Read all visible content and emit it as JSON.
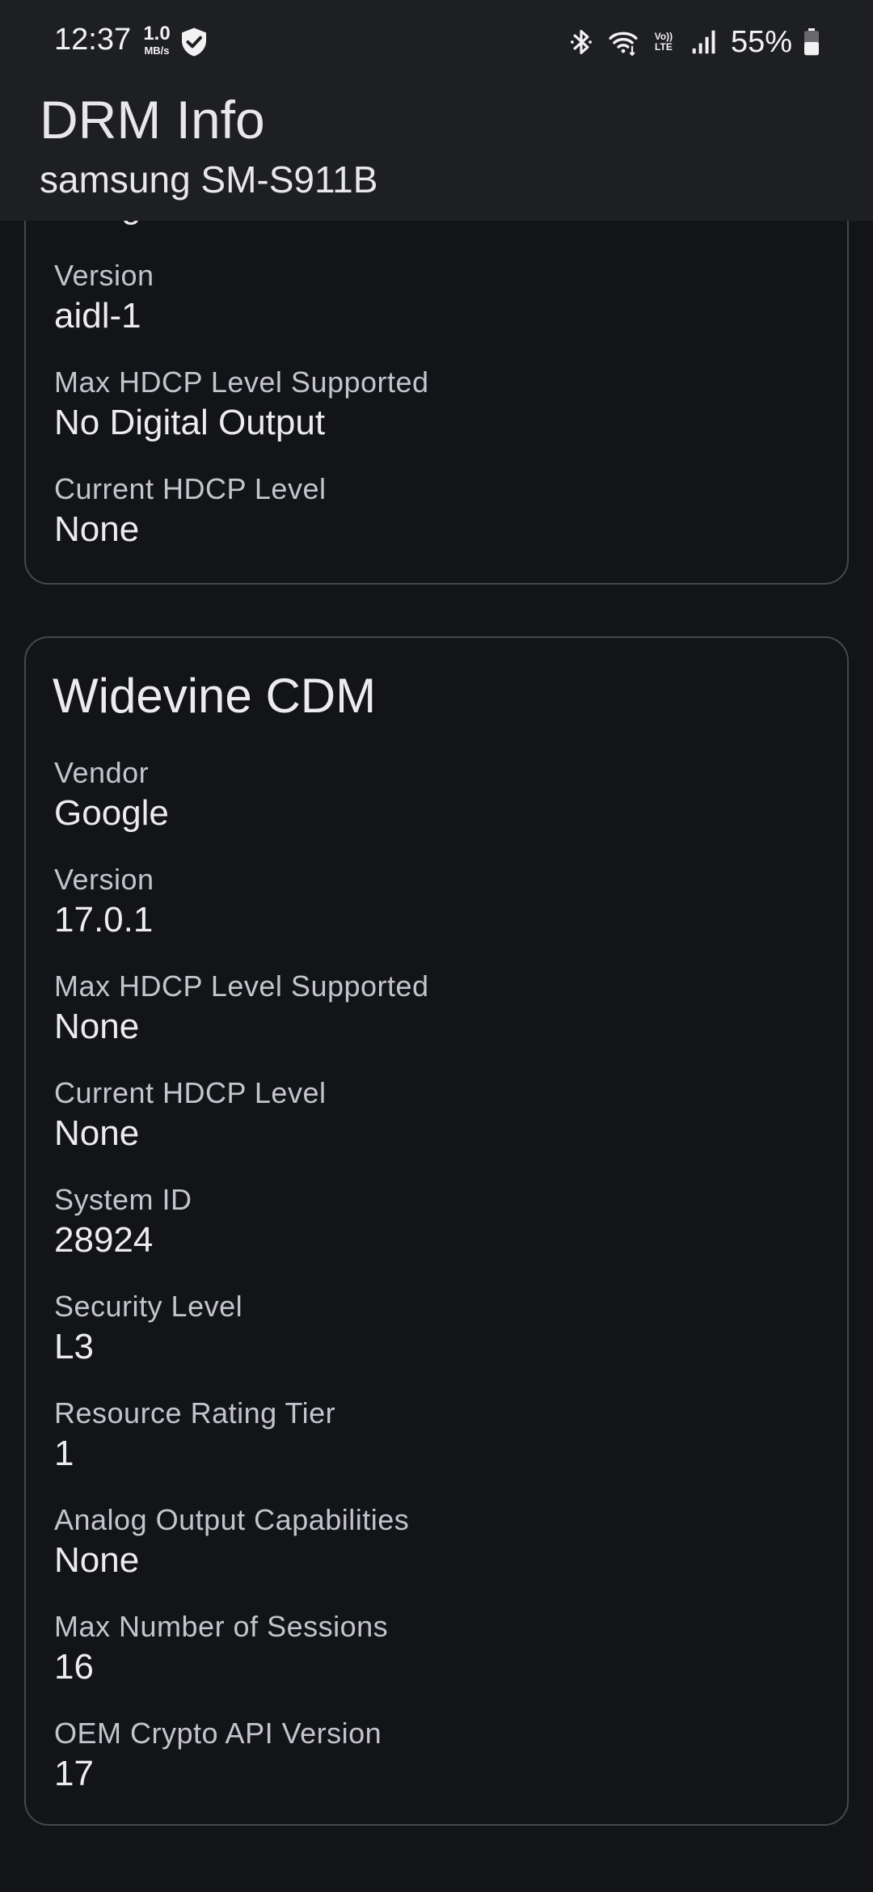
{
  "status_bar": {
    "time": "12:37",
    "speed_value": "1.0",
    "speed_unit": "MB/s",
    "network_type": "Vo)) LTE",
    "battery": "55%"
  },
  "app_bar": {
    "title": "DRM Info",
    "subtitle": "samsung SM-S911B"
  },
  "clearkey_card": {
    "partial_vendor_value": "Google",
    "fields": [
      {
        "label": "Version",
        "value": "aidl-1"
      },
      {
        "label": "Max HDCP Level Supported",
        "value": "No Digital Output"
      },
      {
        "label": "Current HDCP Level",
        "value": "None"
      }
    ]
  },
  "widevine_card": {
    "title": "Widevine CDM",
    "fields": [
      {
        "label": "Vendor",
        "value": "Google"
      },
      {
        "label": "Version",
        "value": "17.0.1"
      },
      {
        "label": "Max HDCP Level Supported",
        "value": "None"
      },
      {
        "label": "Current HDCP Level",
        "value": "None"
      },
      {
        "label": "System ID",
        "value": "28924"
      },
      {
        "label": "Security Level",
        "value": "L3"
      },
      {
        "label": "Resource Rating Tier",
        "value": "1"
      },
      {
        "label": "Analog Output Capabilities",
        "value": "None"
      },
      {
        "label": "Max Number of Sessions",
        "value": "16"
      },
      {
        "label": "OEM Crypto API Version",
        "value": "17"
      }
    ]
  },
  "icons": {
    "shield": "shield-check-icon",
    "bluetooth": "bluetooth-icon",
    "wifi": "wifi-icon",
    "signal": "signal-icon",
    "battery": "battery-icon"
  }
}
